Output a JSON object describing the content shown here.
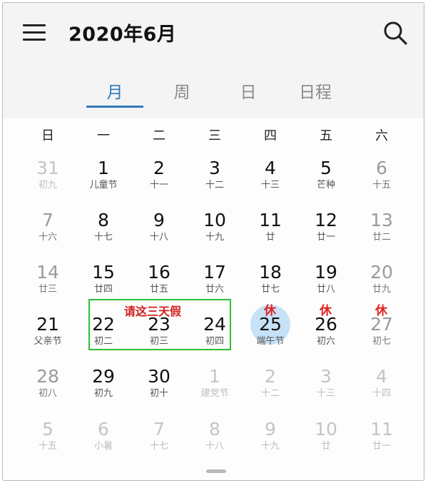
{
  "header": {
    "title": "2020年6月",
    "menu_icon": "menu-icon",
    "search_icon": "search-icon"
  },
  "tabs": [
    {
      "label": "月",
      "active": true
    },
    {
      "label": "周",
      "active": false
    },
    {
      "label": "日",
      "active": false
    },
    {
      "label": "日程",
      "active": false
    }
  ],
  "weekdays": [
    "日",
    "一",
    "二",
    "三",
    "四",
    "五",
    "六"
  ],
  "weeks": [
    [
      {
        "day": "31",
        "sub": "初九",
        "type": "faded"
      },
      {
        "day": "1",
        "sub": "儿童节",
        "type": "normal"
      },
      {
        "day": "2",
        "sub": "十一",
        "type": "normal"
      },
      {
        "day": "3",
        "sub": "十二",
        "type": "normal"
      },
      {
        "day": "4",
        "sub": "十三",
        "type": "normal"
      },
      {
        "day": "5",
        "sub": "芒种",
        "type": "normal"
      },
      {
        "day": "6",
        "sub": "十五",
        "type": "weekend"
      }
    ],
    [
      {
        "day": "7",
        "sub": "十六",
        "type": "weekend"
      },
      {
        "day": "8",
        "sub": "十七",
        "type": "normal"
      },
      {
        "day": "9",
        "sub": "十八",
        "type": "normal"
      },
      {
        "day": "10",
        "sub": "十九",
        "type": "normal"
      },
      {
        "day": "11",
        "sub": "廿",
        "type": "normal"
      },
      {
        "day": "12",
        "sub": "廿一",
        "type": "normal"
      },
      {
        "day": "13",
        "sub": "廿二",
        "type": "weekend"
      }
    ],
    [
      {
        "day": "14",
        "sub": "廿三",
        "type": "weekend"
      },
      {
        "day": "15",
        "sub": "廿四",
        "type": "normal"
      },
      {
        "day": "16",
        "sub": "廿五",
        "type": "normal"
      },
      {
        "day": "17",
        "sub": "廿六",
        "type": "normal"
      },
      {
        "day": "18",
        "sub": "廿七",
        "type": "normal"
      },
      {
        "day": "19",
        "sub": "廿八",
        "type": "normal"
      },
      {
        "day": "20",
        "sub": "廿九",
        "type": "weekend"
      }
    ],
    [
      {
        "day": "21",
        "sub": "父亲节",
        "type": "normal"
      },
      {
        "day": "22",
        "sub": "初二",
        "type": "normal"
      },
      {
        "day": "23",
        "sub": "初三",
        "type": "normal"
      },
      {
        "day": "24",
        "sub": "初四",
        "type": "normal"
      },
      {
        "day": "25",
        "sub": "端午节",
        "type": "today",
        "rest": "休"
      },
      {
        "day": "26",
        "sub": "初六",
        "type": "normal",
        "rest": "休"
      },
      {
        "day": "27",
        "sub": "初七",
        "type": "weekend",
        "rest": "休"
      }
    ],
    [
      {
        "day": "28",
        "sub": "初八",
        "type": "weekend"
      },
      {
        "day": "29",
        "sub": "初九",
        "type": "normal"
      },
      {
        "day": "30",
        "sub": "初十",
        "type": "normal"
      },
      {
        "day": "1",
        "sub": "建党节",
        "type": "faded"
      },
      {
        "day": "2",
        "sub": "十二",
        "type": "faded"
      },
      {
        "day": "3",
        "sub": "十三",
        "type": "faded"
      },
      {
        "day": "4",
        "sub": "十四",
        "type": "faded"
      }
    ],
    [
      {
        "day": "5",
        "sub": "十五",
        "type": "faded"
      },
      {
        "day": "6",
        "sub": "小暑",
        "type": "faded"
      },
      {
        "day": "7",
        "sub": "十七",
        "type": "faded"
      },
      {
        "day": "8",
        "sub": "十八",
        "type": "faded"
      },
      {
        "day": "9",
        "sub": "十九",
        "type": "faded"
      },
      {
        "day": "10",
        "sub": "廿",
        "type": "faded"
      },
      {
        "day": "11",
        "sub": "廿一",
        "type": "faded"
      }
    ]
  ],
  "annotation": {
    "text": "请这三天假",
    "box_color": "#2fbd3c",
    "text_color": "#d52020"
  },
  "colors": {
    "accent": "#2e79b9",
    "today_bg": "#c7e1f7",
    "rest_mark": "#e02222"
  }
}
